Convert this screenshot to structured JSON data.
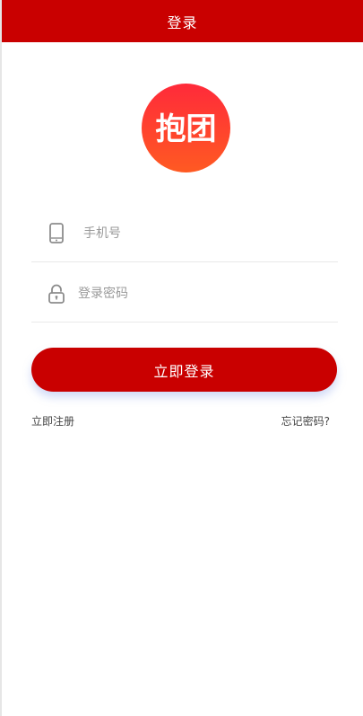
{
  "header": {
    "title": "登录"
  },
  "logo": {
    "text": "抱团"
  },
  "form": {
    "phone_placeholder": "手机号",
    "password_placeholder": "登录密码",
    "login_label": "立即登录"
  },
  "links": {
    "register": "立即注册",
    "forgot": "忘记密码?"
  },
  "icons": {
    "phone": "mobile-phone-icon",
    "lock": "lock-icon"
  },
  "colors": {
    "brand": "#c90000",
    "logo_gradient_top": "#ff2a3a",
    "logo_gradient_bottom": "#ff5a22"
  }
}
